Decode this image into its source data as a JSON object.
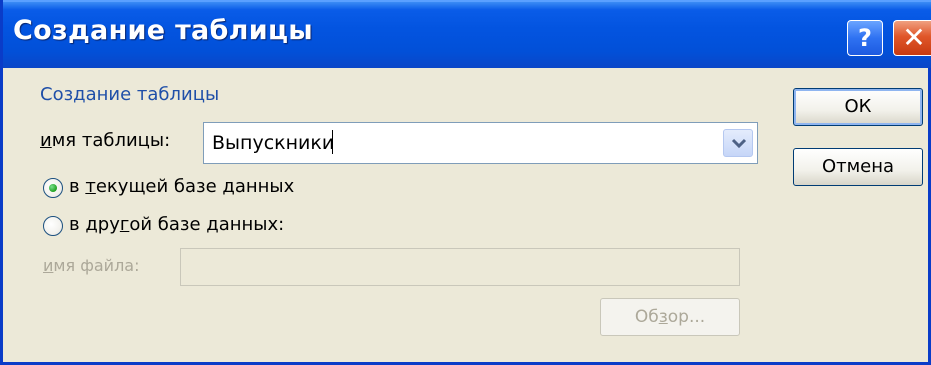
{
  "window": {
    "title": "Создание таблицы",
    "help_label": "?",
    "close_label": "✕"
  },
  "dialog": {
    "group_legend": "Создание таблицы",
    "table_name_label_prefix": "и",
    "table_name_label_rest": "мя таблицы:",
    "table_name_value": "Выпускники",
    "radio_current": {
      "prefix": "в ",
      "underlined": "т",
      "rest": "екущей базе данных",
      "checked": true
    },
    "radio_other": {
      "prefix": "в дру",
      "underlined": "г",
      "rest": "ой базе данных:",
      "checked": false
    },
    "file_label_prefix": "и",
    "file_label_rest": "мя файла:",
    "file_value": "",
    "browse": {
      "prefix": "Об",
      "underlined": "з",
      "rest": "ор..."
    }
  },
  "buttons": {
    "ok": "ОК",
    "cancel": "Отмена"
  },
  "colors": {
    "titlebar": "#0354e0",
    "dialog_bg": "#ece9d8",
    "legend": "#1f4fa8",
    "disabled_text": "#aca899"
  },
  "icons": {
    "combo_dropdown": "chevron-down-icon",
    "help": "question-icon",
    "close": "close-icon"
  }
}
